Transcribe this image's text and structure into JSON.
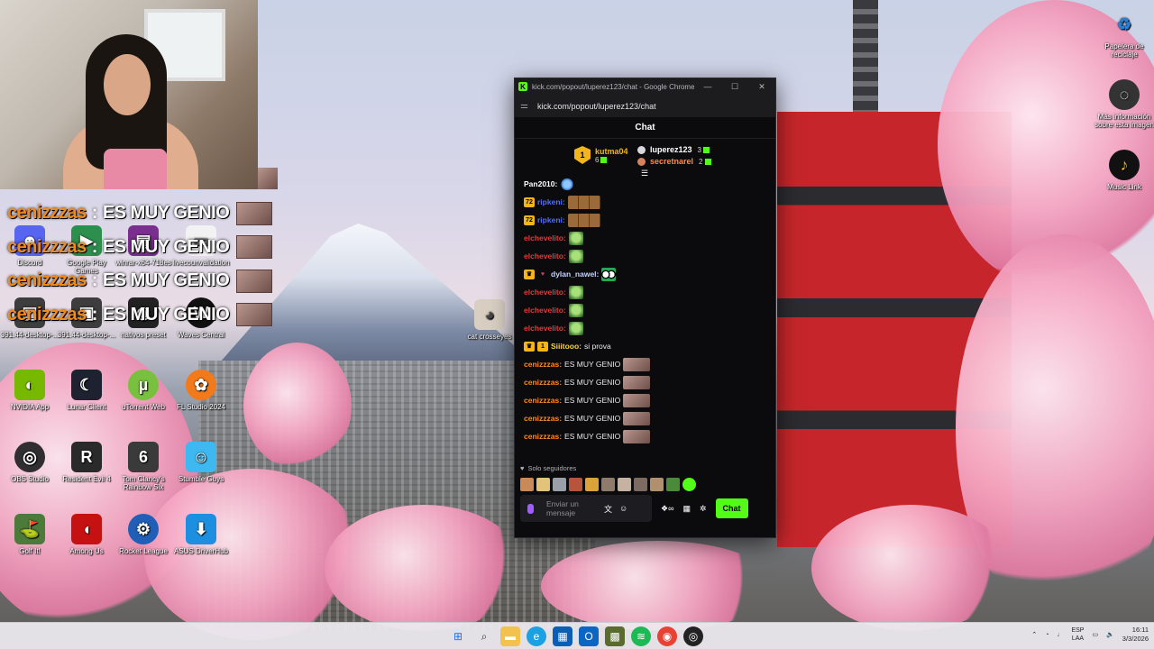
{
  "overlay_chat": [
    {
      "user": "cenizzzas",
      "message": "ES MUY GENIO"
    },
    {
      "user": "cenizzzas",
      "message": "ES MUY GENIO"
    },
    {
      "user": "cenizzzas",
      "message": "ES MUY GENIO"
    },
    {
      "user": "cenizzzas",
      "message": "ES MUY GENIO"
    }
  ],
  "desktop_icons": {
    "discord": "Discord",
    "google_play": "Google Play Games",
    "winrar": "winrar-x64-718es",
    "livecounter": "livecounvalidation",
    "desktop1": "391.44-desktop-...",
    "desktop2": "391.44-desktop-...",
    "nativos": "nativos preset",
    "waves": "Waves Central",
    "nvidia": "NVIDIA App",
    "lunar": "Lunar Client",
    "utorrent": "uTorrent Web",
    "flstudio": "FL Studio 2024",
    "obs": "OBS Studio",
    "resident": "Resident Evil 4",
    "rainbow": "Tom Clancy's Rainbow Six",
    "stumble": "Stumble Guys",
    "golf": "Golf It!",
    "amongus": "Among Us",
    "rocket": "Rocket League",
    "asus": "ASUS DriverHub",
    "catcrosseyes": "cat crosseyes",
    "recycle": "Papelera de reciclaje",
    "info": "Más información sobre esta imagen",
    "music": "Music Link"
  },
  "window": {
    "title": "kick.com/popout/luperez123/chat - Google Chrome",
    "url": "kick.com/popout/luperez123/chat",
    "header": "Chat",
    "minimize": "—",
    "maximize": "☐",
    "close": "✕"
  },
  "leaderboard": {
    "top": {
      "rank": "1",
      "name": "kutma04",
      "count": "6"
    },
    "others": [
      {
        "name": "luperez123",
        "count": "3"
      },
      {
        "name": "secretnarel",
        "count": "2"
      }
    ]
  },
  "messages": [
    {
      "user": "Pan2010:",
      "color": "#ffffff",
      "badges": [],
      "text": "",
      "emote": "bird"
    },
    {
      "user": "ripkeni:",
      "color": "#4f6cff",
      "badges": [
        "sub"
      ],
      "text": "",
      "emote": "bears"
    },
    {
      "user": "ripkeni:",
      "color": "#4f6cff",
      "badges": [
        "sub"
      ],
      "text": "",
      "emote": "bears"
    },
    {
      "user": "elchevelito:",
      "color": "#e23a3a",
      "badges": [],
      "text": "",
      "emote": "green"
    },
    {
      "user": "elchevelito:",
      "color": "#e23a3a",
      "badges": [],
      "text": "",
      "emote": "green"
    },
    {
      "user": "dylan_nawel:",
      "color": "#c7d2ff",
      "badges": [
        "crown",
        "heart"
      ],
      "text": "",
      "emote": "eyes"
    },
    {
      "user": "elchevelito:",
      "color": "#e23a3a",
      "badges": [],
      "text": "",
      "emote": "green"
    },
    {
      "user": "elchevelito:",
      "color": "#e23a3a",
      "badges": [],
      "text": "",
      "emote": "green"
    },
    {
      "user": "elchevelito:",
      "color": "#e23a3a",
      "badges": [],
      "text": "",
      "emote": "green"
    },
    {
      "user": "Siiitooo:",
      "color": "#ffd23a",
      "badges": [
        "crown",
        "one"
      ],
      "text": "si prova",
      "emote": ""
    },
    {
      "user": "cenizzzas:",
      "color": "#ff8a1a",
      "badges": [],
      "text": "ES MUY GENIO",
      "emote": "face"
    },
    {
      "user": "cenizzzas:",
      "color": "#ff8a1a",
      "badges": [],
      "text": "ES MUY GENIO",
      "emote": "face"
    },
    {
      "user": "cenizzzas:",
      "color": "#ff8a1a",
      "badges": [],
      "text": "ES MUY GENIO",
      "emote": "face"
    },
    {
      "user": "cenizzzas:",
      "color": "#ff8a1a",
      "badges": [],
      "text": "ES MUY GENIO",
      "emote": "face"
    },
    {
      "user": "cenizzzas:",
      "color": "#ff8a1a",
      "badges": [],
      "text": "ES MUY GENIO",
      "emote": "face"
    }
  ],
  "chat_footer": {
    "followers_only": "Solo seguidores",
    "input_placeholder": "Enviar un mensaje",
    "send_button": "Chat"
  },
  "taskbar": {
    "lang_line1": "ESP",
    "lang_line2": "LAA",
    "time": "16:11",
    "date": "3/3/2026"
  },
  "colors": {
    "kick_green": "#53fc18",
    "cenizzzas_orange": "#ff8a1a"
  }
}
